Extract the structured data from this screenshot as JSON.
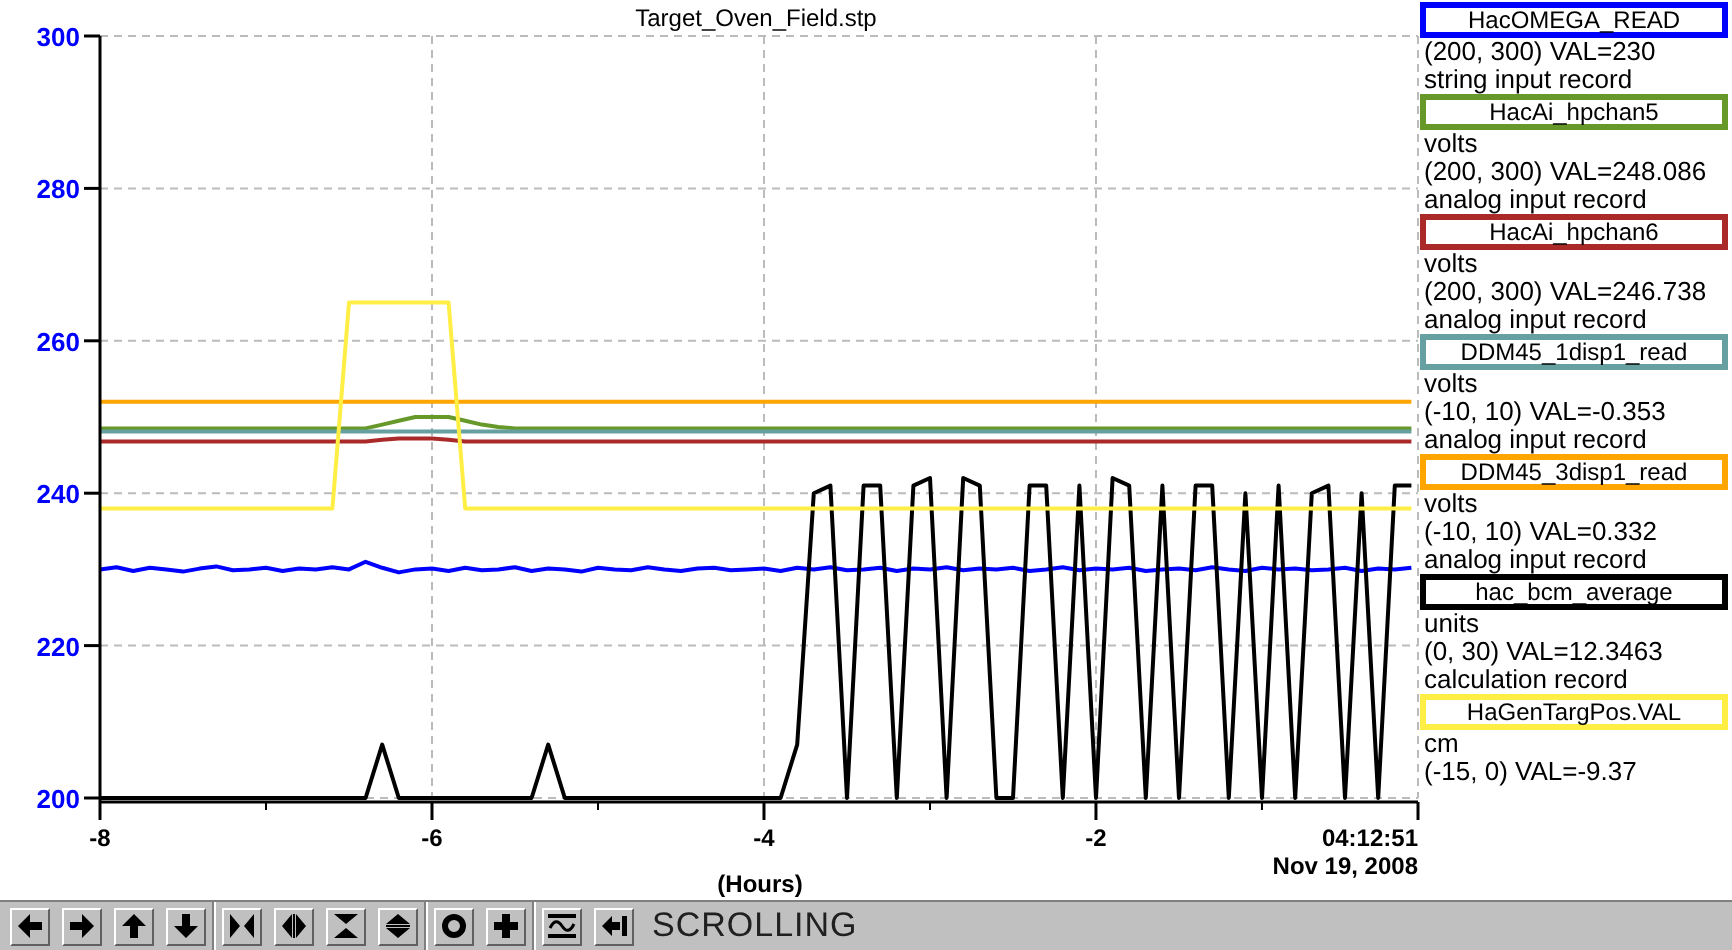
{
  "plot": {
    "title": "Target_Oven_Field.stp",
    "timestamp": [
      "04:12:51",
      "Nov 19, 2008"
    ],
    "chart_data": {
      "type": "line",
      "grid": true,
      "xlabel": "(Hours)",
      "xlim": [
        -8,
        -0.06
      ],
      "ylim": [
        200,
        300
      ],
      "xticks": [
        -8,
        -6,
        -4,
        -2
      ],
      "yticks": [
        200,
        220,
        240,
        260,
        280,
        300
      ],
      "x": [
        -8,
        -7.9,
        -7.8,
        -7.7,
        -7.6,
        -7.5,
        -7.4,
        -7.3,
        -7.2,
        -7.1,
        -7,
        -6.9,
        -6.8,
        -6.7,
        -6.6,
        -6.5,
        -6.4,
        -6.3,
        -6.2,
        -6.1,
        -6,
        -5.9,
        -5.8,
        -5.7,
        -5.6,
        -5.5,
        -5.4,
        -5.3,
        -5.2,
        -5.1,
        -5,
        -4.9,
        -4.8,
        -4.7,
        -4.6,
        -4.5,
        -4.4,
        -4.3,
        -4.2,
        -4.1,
        -4,
        -3.9,
        -3.8,
        -3.7,
        -3.6,
        -3.5,
        -3.4,
        -3.3,
        -3.2,
        -3.1,
        -3,
        -2.9,
        -2.8,
        -2.7,
        -2.6,
        -2.5,
        -2.4,
        -2.3,
        -2.2,
        -2.1,
        -2,
        -1.9,
        -1.8,
        -1.7,
        -1.6,
        -1.5,
        -1.4,
        -1.3,
        -1.2,
        -1.1,
        -1,
        -0.9,
        -0.8,
        -0.7,
        -0.6,
        -0.5,
        -0.4,
        -0.3,
        -0.2,
        -0.1
      ],
      "series": [
        {
          "name": "HacOMEGA_READ",
          "color": "#0000ff",
          "values": [
            230,
            230.3,
            229.8,
            230.2,
            230,
            229.7,
            230.1,
            230.4,
            229.9,
            230,
            230.2,
            229.8,
            230.1,
            230,
            230.3,
            230,
            231,
            230.2,
            229.6,
            230,
            230.1,
            229.8,
            230.2,
            229.9,
            230,
            230.3,
            229.8,
            230.1,
            230,
            229.7,
            230.2,
            230,
            229.9,
            230.3,
            230,
            229.8,
            230.1,
            230.2,
            229.9,
            230,
            230.1,
            229.8,
            230.2,
            230,
            230.3,
            229.9,
            230,
            230.2,
            229.8,
            230.1,
            230,
            230.3,
            229.9,
            230.1,
            230,
            230.2,
            229.8,
            230,
            230.3,
            229.9,
            230.1,
            230,
            230.2,
            229.8,
            230,
            230.1,
            229.9,
            230.3,
            230,
            229.8,
            230.2,
            230,
            230.1,
            229.9,
            230,
            230.2,
            229.8,
            230.1,
            230,
            230.2
          ]
        },
        {
          "name": "HacAi_hpchan5",
          "color": "#66992a",
          "values": [
            248.5,
            248.5,
            248.5,
            248.5,
            248.5,
            248.5,
            248.5,
            248.5,
            248.5,
            248.5,
            248.5,
            248.5,
            248.5,
            248.5,
            248.5,
            248.5,
            248.5,
            249,
            249.5,
            250,
            250,
            250,
            249.5,
            249,
            248.7,
            248.5,
            248.5,
            248.5,
            248.5,
            248.5,
            248.5,
            248.5,
            248.5,
            248.5,
            248.5,
            248.5,
            248.5,
            248.5,
            248.5,
            248.5,
            248.5,
            248.5,
            248.5,
            248.5,
            248.5,
            248.5,
            248.5,
            248.5,
            248.5,
            248.5,
            248.5,
            248.5,
            248.5,
            248.5,
            248.5,
            248.5,
            248.5,
            248.5,
            248.5,
            248.5,
            248.5,
            248.5,
            248.5,
            248.5,
            248.5,
            248.5,
            248.5,
            248.5,
            248.5,
            248.5,
            248.5,
            248.5,
            248.5,
            248.5,
            248.5,
            248.5,
            248.5,
            248.5,
            248.5,
            248.5
          ]
        },
        {
          "name": "HacAi_hpchan6",
          "color": "#aa2a2a",
          "values": [
            246.8,
            246.8,
            246.8,
            246.8,
            246.8,
            246.8,
            246.8,
            246.8,
            246.8,
            246.8,
            246.8,
            246.8,
            246.8,
            246.8,
            246.8,
            246.8,
            246.8,
            247,
            247.2,
            247.2,
            247.2,
            247,
            246.8,
            246.8,
            246.8,
            246.8,
            246.8,
            246.8,
            246.8,
            246.8,
            246.8,
            246.8,
            246.8,
            246.8,
            246.8,
            246.8,
            246.8,
            246.8,
            246.8,
            246.8,
            246.8,
            246.8,
            246.8,
            246.8,
            246.8,
            246.8,
            246.8,
            246.8,
            246.8,
            246.8,
            246.8,
            246.8,
            246.8,
            246.8,
            246.8,
            246.8,
            246.8,
            246.8,
            246.8,
            246.8,
            246.8,
            246.8,
            246.8,
            246.8,
            246.8,
            246.8,
            246.8,
            246.8,
            246.8,
            246.8,
            246.8,
            246.8,
            246.8,
            246.8,
            246.8,
            246.8,
            246.8,
            246.8,
            246.8,
            246.8
          ]
        },
        {
          "name": "DDM45_1disp1_read",
          "color": "#66a0a0",
          "values": [
            248.1,
            248.1,
            248.1,
            248.1,
            248.1,
            248.1,
            248.1,
            248.1,
            248.1,
            248.1,
            248.1,
            248.1,
            248.1,
            248.1,
            248.1,
            248.1,
            248.1,
            248.1,
            248.1,
            248.1,
            248.1,
            248.1,
            248.1,
            248.1,
            248.1,
            248.1,
            248.1,
            248.1,
            248.1,
            248.1,
            248.1,
            248.1,
            248.1,
            248.1,
            248.1,
            248.1,
            248.1,
            248.1,
            248.1,
            248.1,
            248.1,
            248.1,
            248.1,
            248.1,
            248.1,
            248.1,
            248.1,
            248.1,
            248.1,
            248.1,
            248.1,
            248.1,
            248.1,
            248.1,
            248.1,
            248.1,
            248.1,
            248.1,
            248.1,
            248.1,
            248.1,
            248.1,
            248.1,
            248.1,
            248.1,
            248.1,
            248.1,
            248.1,
            248.1,
            248.1,
            248.1,
            248.1,
            248.1,
            248.1,
            248.1,
            248.1,
            248.1,
            248.1,
            248.1,
            248.1
          ]
        },
        {
          "name": "DDM45_3disp1_read",
          "color": "#ffa500",
          "values": [
            252,
            252,
            252,
            252,
            252,
            252,
            252,
            252,
            252,
            252,
            252,
            252,
            252,
            252,
            252,
            252,
            252,
            252,
            252,
            252,
            252,
            252,
            252,
            252,
            252,
            252,
            252,
            252,
            252,
            252,
            252,
            252,
            252,
            252,
            252,
            252,
            252,
            252,
            252,
            252,
            252,
            252,
            252,
            252,
            252,
            252,
            252,
            252,
            252,
            252,
            252,
            252,
            252,
            252,
            252,
            252,
            252,
            252,
            252,
            252,
            252,
            252,
            252,
            252,
            252,
            252,
            252,
            252,
            252,
            252,
            252,
            252,
            252,
            252,
            252,
            252,
            252,
            252,
            252,
            252
          ]
        },
        {
          "name": "hac_bcm_average",
          "color": "#000000",
          "values": [
            200,
            200,
            200,
            200,
            200,
            200,
            200,
            200,
            200,
            200,
            200,
            200,
            200,
            200,
            200,
            200,
            200,
            207,
            200,
            200,
            200,
            200,
            200,
            200,
            200,
            200,
            200,
            207,
            200,
            200,
            200,
            200,
            200,
            200,
            200,
            200,
            200,
            200,
            200,
            200,
            200,
            200,
            207,
            240,
            241,
            200,
            241,
            241,
            200,
            241,
            242,
            200,
            242,
            241,
            200,
            200,
            241,
            241,
            200,
            241,
            200,
            242,
            241,
            200,
            241,
            200,
            241,
            241,
            200,
            240,
            200,
            241,
            200,
            240,
            241,
            200,
            240,
            200,
            241,
            241
          ]
        },
        {
          "name": "HaGenTargPos.VAL",
          "color": "#ffee44",
          "values": [
            238,
            238,
            238,
            238,
            238,
            238,
            238,
            238,
            238,
            238,
            238,
            238,
            238,
            238,
            238,
            265,
            265,
            265,
            265,
            265,
            265,
            265,
            238,
            238,
            238,
            238,
            238,
            238,
            238,
            238,
            238,
            238,
            238,
            238,
            238,
            238,
            238,
            238,
            238,
            238,
            238,
            238,
            238,
            238,
            238,
            238,
            238,
            238,
            238,
            238,
            238,
            238,
            238,
            238,
            238,
            238,
            238,
            238,
            238,
            238,
            238,
            238,
            238,
            238,
            238,
            238,
            238,
            238,
            238,
            238,
            238,
            238,
            238,
            238,
            238,
            238,
            238,
            238,
            238,
            238
          ]
        }
      ]
    }
  },
  "legend": [
    {
      "lines": [
        "(200, 300) VAL=230",
        "string input record"
      ]
    },
    {
      "lines": [
        "volts",
        "(200, 300) VAL=248.086",
        "analog input record"
      ]
    },
    {
      "lines": [
        "volts",
        "(200, 300) VAL=246.738",
        "analog input record"
      ]
    },
    {
      "lines": [
        "volts",
        "(-10, 10) VAL=-0.353",
        "analog input record"
      ]
    },
    {
      "lines": [
        "volts",
        "(-10, 10) VAL=0.332",
        "analog input record"
      ]
    },
    {
      "lines": [
        "units",
        "(0, 30) VAL=12.3463",
        "calculation record"
      ]
    },
    {
      "lines": [
        "cm",
        "(-15, 0) VAL=-9.37"
      ]
    }
  ],
  "toolbar": {
    "groups": [
      [
        {
          "kind": "left"
        },
        {
          "kind": "right"
        },
        {
          "kind": "up"
        },
        {
          "kind": "down"
        }
      ],
      [
        {
          "kind": "zoom-in-x"
        },
        {
          "kind": "zoom-out-x"
        },
        {
          "kind": "zoom-in-y"
        },
        {
          "kind": "zoom-out-y"
        }
      ],
      [
        {
          "kind": "circle"
        },
        {
          "kind": "plus"
        }
      ],
      [
        {
          "kind": "graph"
        },
        {
          "kind": "back"
        }
      ]
    ],
    "status": "SCROLLING"
  }
}
